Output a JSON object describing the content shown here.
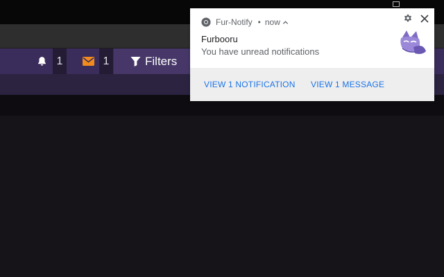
{
  "site": {
    "header": {
      "bell_count": "1",
      "mail_count": "1",
      "filters_label": "Filters"
    }
  },
  "notification": {
    "app_name": "Fur-Notify",
    "separator": "•",
    "time": "now",
    "expand_glyph": "^",
    "title": "Furbooru",
    "message": "You have unread notifications",
    "actions": [
      "VIEW 1 NOTIFICATION",
      "VIEW 1 MESSAGE"
    ]
  },
  "icons": {
    "bell": "bell-icon",
    "mail": "envelope-icon",
    "filter": "filter-icon",
    "chrome": "chrome-icon",
    "gear": "gear-icon",
    "close": "close-icon",
    "logo": "furbooru-fox-logo"
  },
  "colors": {
    "header_bg": "#3b2d5b",
    "filters_bg": "#463768",
    "mail_accent": "#f28b1c",
    "action_link": "#1a73e8",
    "page_bg": "#161319"
  }
}
